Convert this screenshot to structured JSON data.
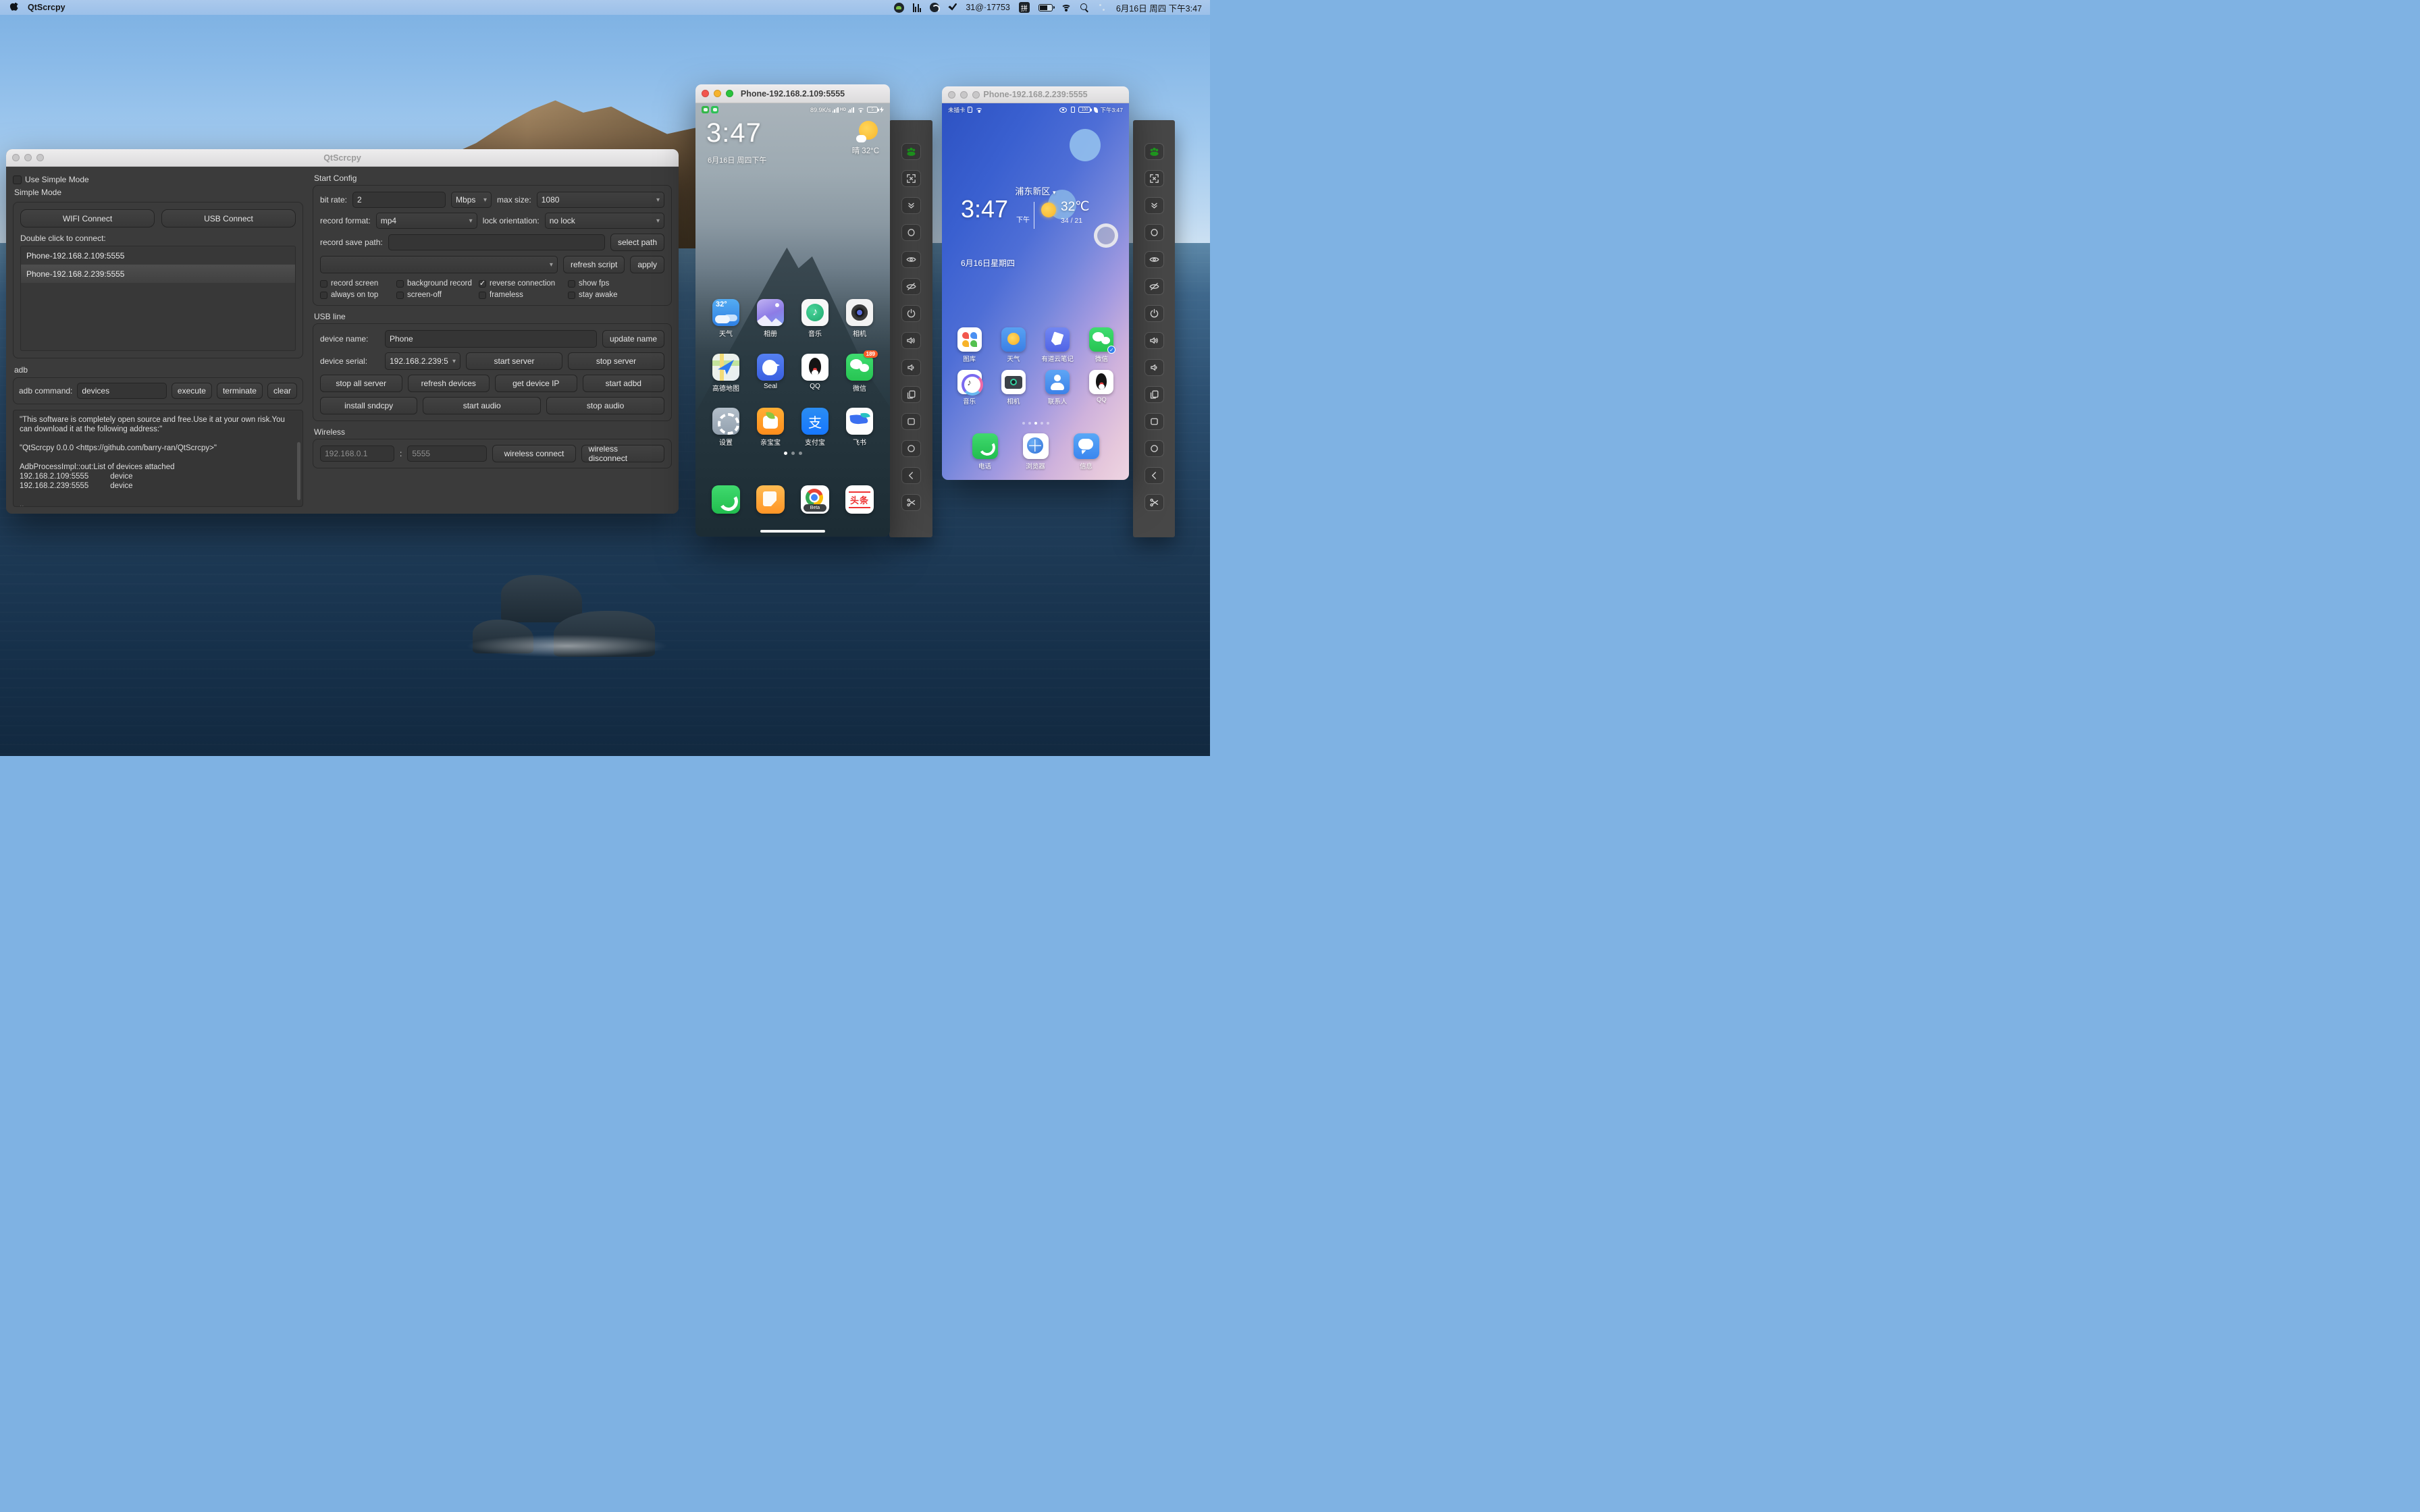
{
  "icons": {
    "dropdown": "▾",
    "check": "✓",
    "location_caret": "▾"
  },
  "menu_bar": {
    "app_name": "QtScrcpy",
    "proxy_text": "31@·17753",
    "ime_badge": "拼",
    "datetime": "6月16日 周四 下午3:47"
  },
  "main_window": {
    "title": "QtScrcpy",
    "use_simple_mode_label": "Use Simple Mode",
    "simple_mode_label": "Simple Mode",
    "wifi_connect": "WIFI Connect",
    "usb_connect": "USB Connect",
    "double_click_label": "Double click to connect:",
    "device_list": [
      "Phone-192.168.2.109:5555",
      "Phone-192.168.2.239:5555"
    ],
    "adb_section_label": "adb",
    "adb_command_label": "adb command:",
    "adb_command_value": "devices",
    "execute": "execute",
    "terminate": "terminate",
    "clear": "clear",
    "log_text": "\"This software is completely open source and free.Use it at your own risk.You can download it at the following address:\"\n\n\"QtScrcpy 0.0.0 <https://github.com/barry-ran/QtScrcpy>\"\n\nAdbProcessImpl::out:List of devices attached\n192.168.2.109:5555          device\n192.168.2.239:5555          device\n\n..",
    "start_config": {
      "title": "Start Config",
      "bit_rate_label": "bit rate:",
      "bit_rate_value": "2",
      "bit_rate_unit": "Mbps",
      "max_size_label": "max size:",
      "max_size_value": "1080",
      "record_format_label": "record format:",
      "record_format_value": "mp4",
      "lock_orientation_label": "lock orientation:",
      "lock_orientation_value": "no lock",
      "record_save_path_label": "record save path:",
      "record_save_path_value": "",
      "select_path": "select path",
      "script_value": "",
      "refresh_script": "refresh script",
      "apply": "apply",
      "checks": {
        "record_screen": "record screen",
        "background_record": "background record",
        "reverse_connection": "reverse connection",
        "show_fps": "show fps",
        "always_on_top": "always on top",
        "screen_off": "screen-off",
        "frameless": "frameless",
        "stay_awake": "stay awake"
      }
    },
    "usb_line": {
      "title": "USB line",
      "device_name_label": "device name:",
      "device_name_value": "Phone",
      "update_name": "update name",
      "device_serial_label": "device serial:",
      "device_serial_value": "192.168.2.239:5",
      "start_server": "start server",
      "stop_server": "stop server",
      "stop_all_server": "stop all server",
      "refresh_devices": "refresh devices",
      "get_device_ip": "get device IP",
      "start_adbd": "start adbd",
      "install_sndcpy": "install sndcpy",
      "start_audio": "start audio",
      "stop_audio": "stop audio"
    },
    "wireless": {
      "title": "Wireless",
      "ip_value": "192.168.0.1",
      "separator": ":",
      "port_value": "5555",
      "wireless_connect": "wireless connect",
      "wireless_disconnect": "wireless disconnect"
    }
  },
  "phone1": {
    "title": "Phone-192.168.2.109:5555",
    "status": {
      "net_speed": "89.9K/s",
      "hd": "HD",
      "battery": "5"
    },
    "clock": "3:47",
    "date": "6月16日 周四下午",
    "weather": "晴 32°C",
    "weather_badge": "32°",
    "wechat_badge": "189",
    "apps": [
      {
        "label": "天气"
      },
      {
        "label": "相册"
      },
      {
        "label": "音乐"
      },
      {
        "label": "相机"
      },
      {
        "label": "高德地图"
      },
      {
        "label": "Seal"
      },
      {
        "label": "QQ"
      },
      {
        "label": "微信"
      },
      {
        "label": "设置"
      },
      {
        "label": "亲宝宝"
      },
      {
        "label": "支付宝"
      },
      {
        "label": "飞书"
      }
    ],
    "alipay_glyph": "支",
    "dock": {
      "beta_label": "Beta",
      "toutiao_text": "头条"
    }
  },
  "phone2": {
    "title": "Phone-192.168.2.239:5555",
    "status_left": "未插卡",
    "battery": "100",
    "status_time": "下午3:47",
    "location": "浦东新区",
    "clock": "3:47",
    "clock_suffix": "下午",
    "temp": "32℃",
    "temp_range": "34 / 21",
    "date": "6月16日星期四",
    "apps_row1": [
      {
        "label": "图库"
      },
      {
        "label": "天气"
      },
      {
        "label": "有道云笔记"
      },
      {
        "label": "微信"
      }
    ],
    "apps_row2": [
      {
        "label": "音乐"
      },
      {
        "label": "相机"
      },
      {
        "label": "联系人"
      },
      {
        "label": "QQ"
      }
    ],
    "dock": [
      {
        "label": "电话"
      },
      {
        "label": "浏览器"
      },
      {
        "label": "信息"
      }
    ],
    "wechat_check": "✓"
  },
  "toolbar": {
    "buttons": [
      "group-control",
      "fullscreen",
      "expand-notification",
      "touch",
      "screen-on",
      "screen-off",
      "power",
      "volume-up",
      "volume-down",
      "app-switch",
      "menu",
      "home",
      "back",
      "screenshot"
    ]
  }
}
